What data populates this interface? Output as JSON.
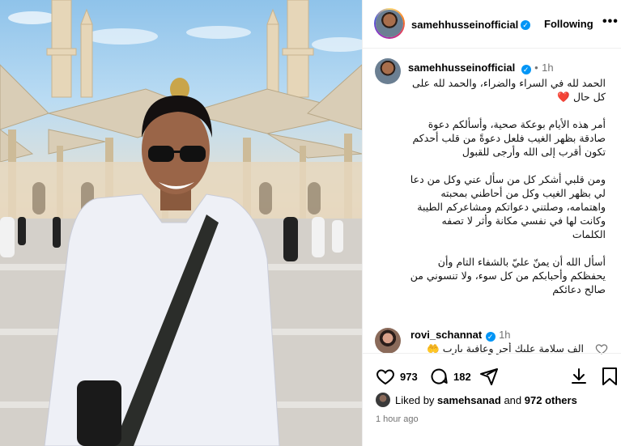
{
  "post": {
    "author": "samehhusseinofficial",
    "follow_label": "Following",
    "more_label": "•••",
    "verified_mark": "✓"
  },
  "caption": {
    "author": "samehhusseinofficial",
    "time": "1h",
    "paragraphs": [
      "الحمد لله في السراء والضراء، والحمد لله على كل حال",
      "أمر هذه الأيام بوعكة صحية، وأسألكم دعوة صادقة بظهر الغيب فلعل دعوةً من قلب أحدكم تكون أقرب إلى الله وأرجى للقبول",
      "ومن قلبي أشكر كل من سأل عني وكل من دعا لي بظهر الغيب وكل من أحاطني بمحبته واهتمامه، وصلتني دعواتكم ومشاعركم الطيبة وكانت لها في نفسي مكانة وأثر لا تصفه الكلمات",
      "أسأل الله أن يمنّ عليّ بالشفاء التام وأن يحفظكم وأحبابكم من كل سوء، ولا تنسوني من صالح دعائكم"
    ],
    "heart_emoji": "❤️"
  },
  "comment": {
    "author": "rovi_schannat",
    "time": "1h",
    "text": "الف سلامة عليك أجر وعافية يارب 🤲"
  },
  "actions": {
    "likes_count": "973",
    "comments_count": "182"
  },
  "liked_by": {
    "prefix": "Liked by",
    "user": "samehsanad",
    "middle": "and",
    "others": "972 others"
  },
  "timestamp": "1 hour ago",
  "icons": [
    "heart-icon",
    "comment-icon",
    "share-icon",
    "save-icon",
    "bookmark-icon",
    "more-icon",
    "verified-icon"
  ],
  "colors": {
    "verified": "#0095f6",
    "muted": "#737373",
    "heart": "#e0245e"
  }
}
